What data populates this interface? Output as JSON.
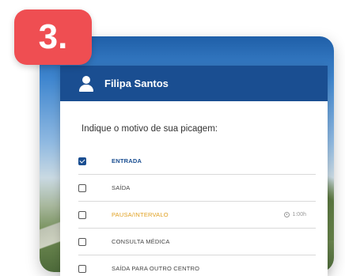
{
  "step_badge": "3.",
  "header": {
    "user_name": "Filipa Santos"
  },
  "prompt": "Indique o motivo de sua picagem:",
  "options": [
    {
      "label": "ENTRADA",
      "checked": true
    },
    {
      "label": "SAÍDA",
      "checked": false
    },
    {
      "label": "PAUSA/INTERVALO",
      "checked": false,
      "meta": "1:00h"
    },
    {
      "label": "CONSULTA MÉDICA",
      "checked": false
    },
    {
      "label": "SAÍDA PARA OUTRO CENTRO",
      "checked": false
    }
  ],
  "colors": {
    "header": "#1a4e91",
    "badge": "#ef4e52",
    "warning": "#e0a020"
  }
}
